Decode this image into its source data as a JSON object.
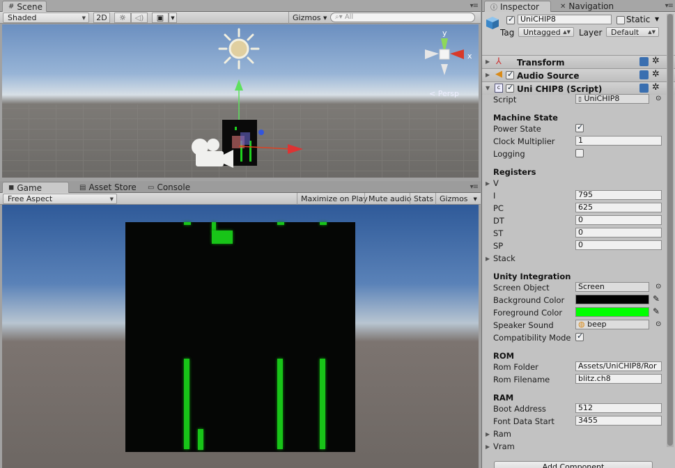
{
  "scene_panel": {
    "tab_label": "Scene",
    "shading_mode": "Shaded",
    "btn_2d": "2D",
    "gizmos_label": "Gizmos",
    "search_placeholder": "All",
    "persp_label": "< Persp",
    "axis_y": "y",
    "axis_x": "x"
  },
  "game_panel": {
    "tabs": [
      "Game",
      "Asset Store",
      "Console"
    ],
    "aspect": "Free Aspect",
    "maximize_on_play": "Maximize on Play",
    "mute_audio": "Mute audio",
    "stats": "Stats",
    "gizmos": "Gizmos"
  },
  "inspector": {
    "tabs": [
      "Inspector",
      "Navigation"
    ],
    "object_name": "UniCHIP8",
    "static_label": "Static",
    "tag_label": "Tag",
    "tag_value": "Untagged",
    "layer_label": "Layer",
    "layer_value": "Default",
    "components": {
      "transform": "Transform",
      "audio_source": "Audio Source",
      "script": "Uni CHIP8 (Script)"
    },
    "script_label": "Script",
    "script_value": "UniCHIP8",
    "machine_state": {
      "title": "Machine State",
      "power_state": "Power State",
      "clock_multiplier": "Clock Multiplier",
      "clock_multiplier_value": "1",
      "logging": "Logging"
    },
    "registers": {
      "title": "Registers",
      "v": "V",
      "i": "I",
      "i_value": "795",
      "pc": "PC",
      "pc_value": "625",
      "dt": "DT",
      "dt_value": "0",
      "st": "ST",
      "st_value": "0",
      "sp": "SP",
      "sp_value": "0",
      "stack": "Stack"
    },
    "unity_integration": {
      "title": "Unity Integration",
      "screen_object": "Screen Object",
      "screen_object_value": "Screen",
      "background_color": "Background Color",
      "background_color_value": "#000000",
      "foreground_color": "Foreground Color",
      "foreground_color_value": "#00ff00",
      "speaker_sound": "Speaker Sound",
      "speaker_sound_value": "beep",
      "compatibility_mode": "Compatibility Mode"
    },
    "rom": {
      "title": "ROM",
      "rom_folder": "Rom Folder",
      "rom_folder_value": "Assets/UniCHIP8/Ror",
      "rom_filename": "Rom Filename",
      "rom_filename_value": "blitz.ch8"
    },
    "ram": {
      "title": "RAM",
      "boot_address": "Boot Address",
      "boot_address_value": "512",
      "font_data_start": "Font Data Start",
      "font_data_start_value": "3455",
      "ram": "Ram",
      "vram": "Vram"
    },
    "add_component": "Add Component"
  }
}
